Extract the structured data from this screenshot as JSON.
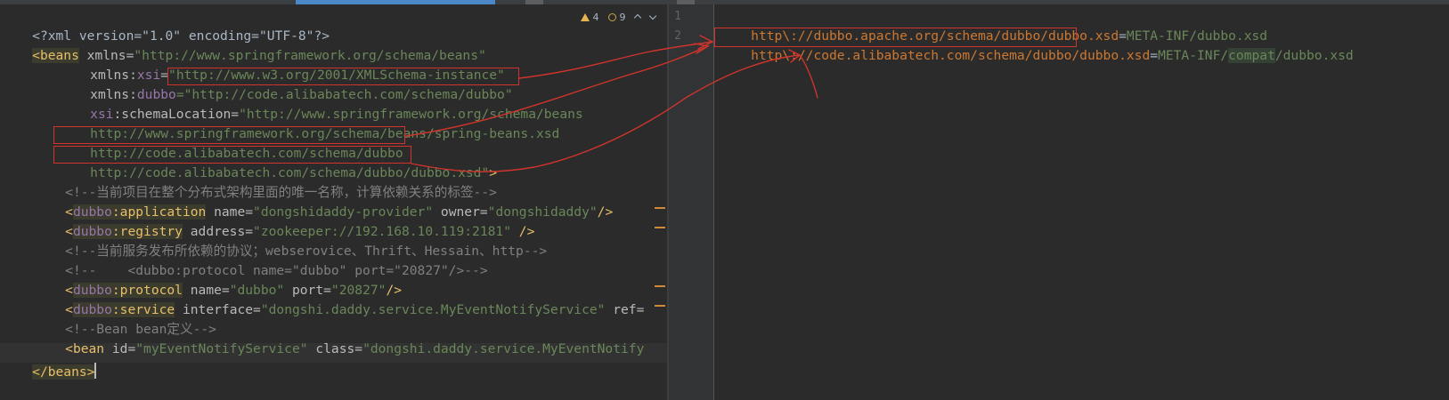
{
  "editor": {
    "left_lines": [
      [
        "<?",
        "xml version=\"1.0\" encoding=\"UTF-8\"",
        "?>"
      ],
      null
    ],
    "xml_decl": "<?xml version=\"1.0\" encoding=\"UTF-8\"?>",
    "l2_open": "<beans",
    "l2_attr": " xmlns=",
    "l2_val": "\"http://www.springframework.org/schema/beans\"",
    "l3_attr": "xmlns:",
    "l3_ns": "xsi",
    "l3_eq": "=",
    "l3_val": "\"http://www.w3.org/2001/XMLSchema-instance\"",
    "l4_attr": "xmlns:",
    "l4_ns": "dubbo",
    "l4_eq": "=\"",
    "l4_val": "http://code.alibabatech.com/schema/dubbo",
    "l4_end": "\"",
    "l5_ns": "xsi",
    "l5_attr": ":schemaLocation=",
    "l5_val": "\"http://www.springframework.org/schema/beans",
    "l6_val": "http://www.springframework.org/schema/beans/spring-beans.xsd",
    "l7_val": "http://code.alibabatech.com/schema/dubbo",
    "l8_val_a": "http://code.alibabatech.com/schema/dubbo/",
    "l8_val_b": "dubbo.xsd\"",
    "l8_end": ">",
    "l9_com": "<!--当前项目在整个分布式架构里面的唯一名称，计算依赖关系的标签-->",
    "l10_open": "<",
    "l10_ns": "dubbo",
    "l10_tag": ":application",
    "l10_a1": " name=",
    "l10_v1": "\"dongshidaddy-provider\"",
    "l10_a2": " owner=",
    "l10_v2": "\"dongshidaddy\"",
    "l10_close": "/>",
    "l11_open": "<",
    "l11_ns": "dubbo",
    "l11_tag": ":registry",
    "l11_a1": " address=",
    "l11_v1": "\"zookeeper://192.168.10.119:2181\"",
    "l11_close": " />",
    "l12_com": "<!--当前服务发布所依赖的协议；webserovice、Thrift、Hessain、http-->",
    "l13_com": "<!--    <dubbo:protocol name=\"dubbo\" port=\"20827\"/>-->",
    "l14_open": "<",
    "l14_ns": "dubbo",
    "l14_tag": ":protocol",
    "l14_a1": " name=",
    "l14_v1": "\"dubbo\"",
    "l14_a2": " port=",
    "l14_v2": "\"20827\"",
    "l14_close": "/>",
    "l15_open": "<",
    "l15_ns": "dubbo",
    "l15_tag": ":service",
    "l15_a1": " interface=",
    "l15_v1": "\"dongshi.daddy.service.MyEventNotifyService\"",
    "l15_a2": " ref=",
    "l16_com": "<!--Bean bean定义-->",
    "l17_open": "<bean",
    "l17_a1": " id=",
    "l17_v1": "\"myEventNotifyService\"",
    "l17_a2": " class=",
    "l17_v2": "\"dongshi.daddy.service.MyEventNotify",
    "l18_close": "</beans>"
  },
  "inspections": {
    "warnings": "4",
    "weak_warnings": "9"
  },
  "right_editor": {
    "line_numbers": [
      "1",
      "2"
    ],
    "line1_key": "http\\://dubbo.apache.org/schema/dubbo/dubbo.xsd",
    "line1_eq": "=",
    "line1_val": "META-INF/dubbo.xsd",
    "line2_key_a": "http\\://code.alibabatech.com/schema/dubbo",
    "line2_key_b": "/dubbo.xsd",
    "line2_eq": "=",
    "line2_val_a": "META-INF/",
    "line2_val_b": "compat",
    "line2_val_c": "/dubbo.xsd"
  },
  "colors": {
    "annotation_red": "#d0342c",
    "background": "#2b2b2b"
  }
}
